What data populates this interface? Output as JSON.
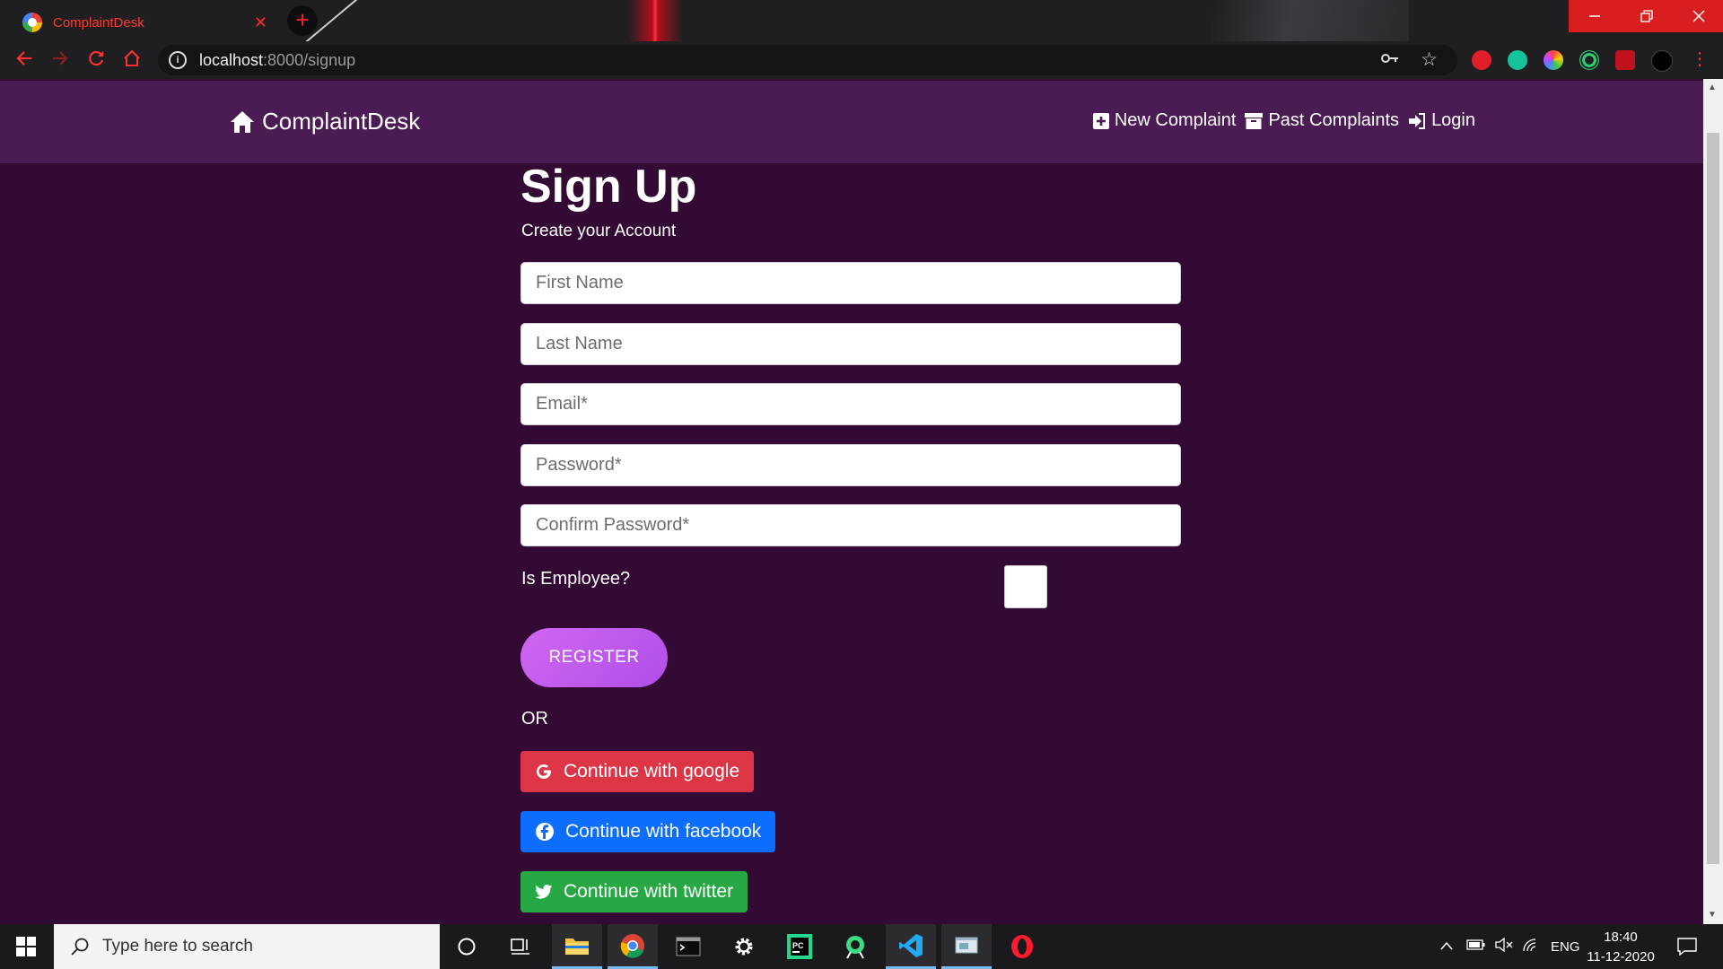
{
  "browser": {
    "tab_title": "ComplaintDesk",
    "url_host": "localhost",
    "url_path": ":8000/signup",
    "icons": [
      "back-icon",
      "forward-icon",
      "reload-icon",
      "home-icon",
      "site-info-icon",
      "key-icon",
      "star-icon"
    ]
  },
  "site": {
    "brand": "ComplaintDesk",
    "nav": {
      "new_complaint": "New Complaint",
      "past_complaints": "Past Complaints",
      "login": "Login"
    },
    "colors": {
      "navbar": "#4b1c53",
      "background": "#320a33"
    }
  },
  "form": {
    "title": "Sign Up",
    "subtitle": "Create your Account",
    "first_name_placeholder": "First Name",
    "last_name_placeholder": "Last Name",
    "email_placeholder": "Email*",
    "password_placeholder": "Password*",
    "confirm_password_placeholder": "Confirm Password*",
    "employee_label": "Is Employee?",
    "register_label": "REGISTER",
    "or_label": "OR",
    "google_label": "Continue with google",
    "facebook_label": "Continue with facebook",
    "twitter_label": "Continue with twitter"
  },
  "taskbar": {
    "search_placeholder": "Type here to search",
    "language": "ENG",
    "time": "18:40",
    "date": "11-12-2020"
  }
}
